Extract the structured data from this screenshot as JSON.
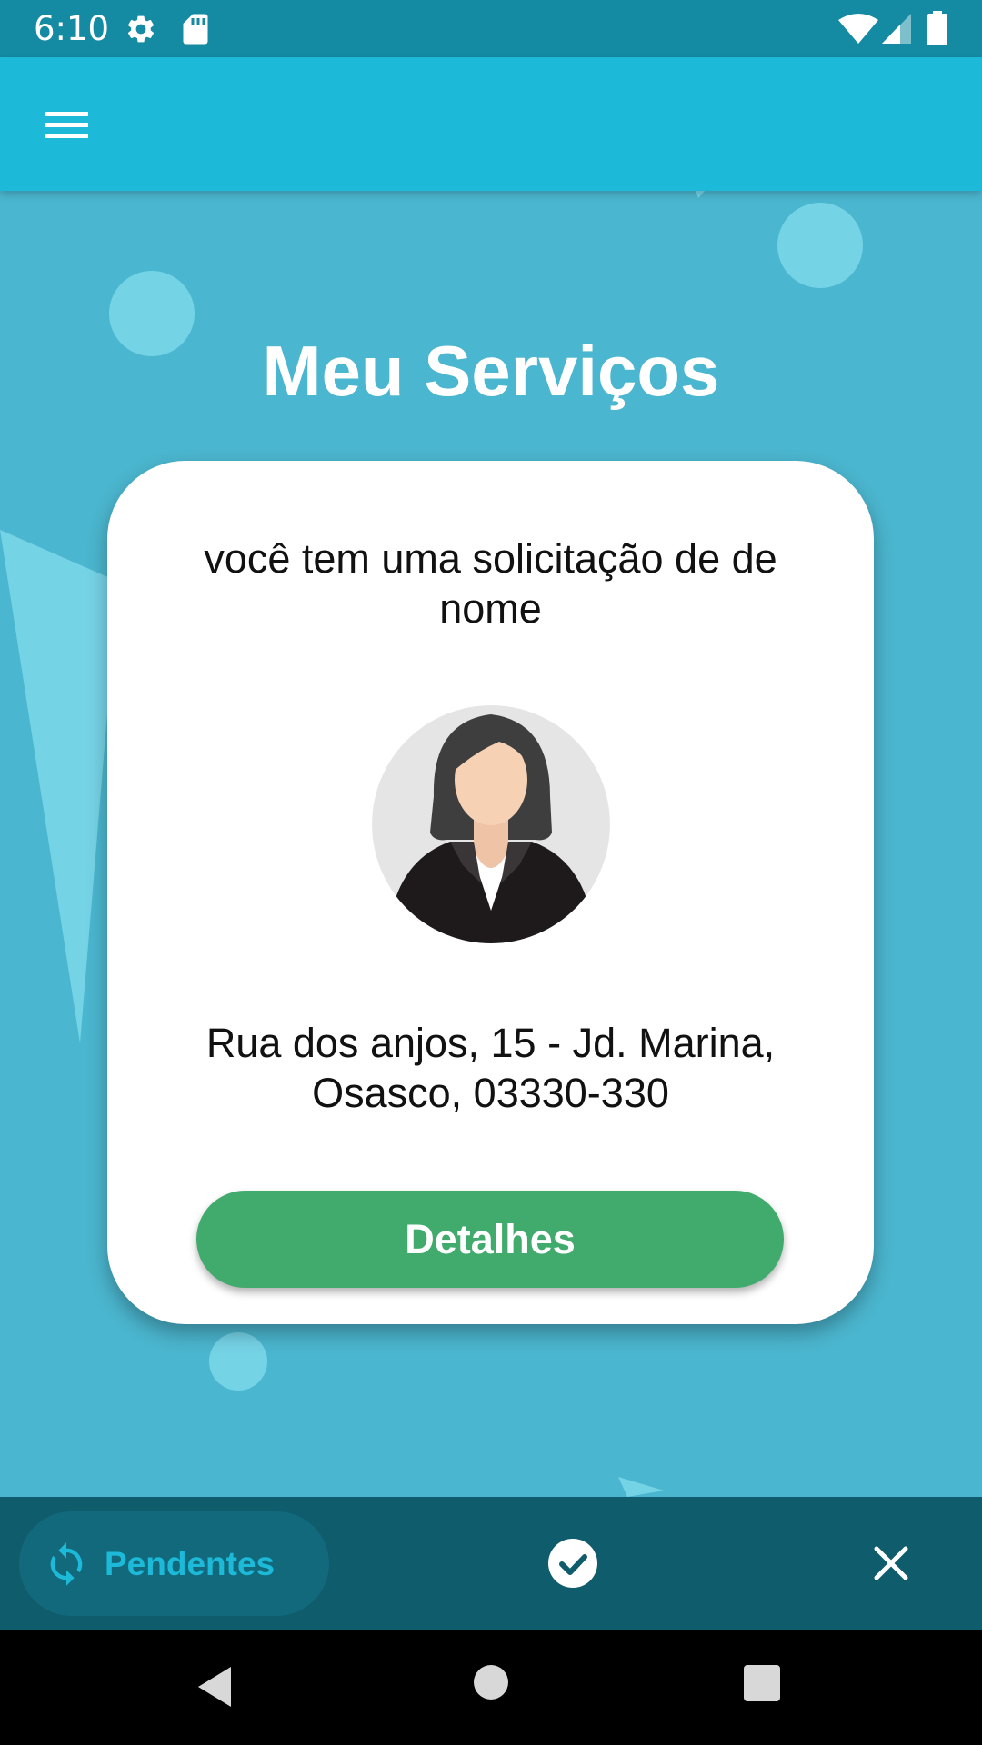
{
  "status_bar": {
    "time": "6:10",
    "icons": [
      "settings-icon",
      "sd-card-icon",
      "wifi-icon",
      "signal-icon",
      "battery-icon"
    ]
  },
  "app_bar": {
    "menu_icon": "hamburger-menu-icon"
  },
  "page": {
    "title": "Meu Serviços"
  },
  "card": {
    "message": "você tem uma solicitação de de nome",
    "avatar": "woman-avatar",
    "address_line1": "Rua dos anjos, 15 - Jd. Marina,",
    "address_line2": "Osasco, 03330-330",
    "details_label": "Detalhes"
  },
  "bottom_nav": {
    "tabs": [
      {
        "label": "Pendentes",
        "icon": "sync-icon",
        "selected": true
      },
      {
        "label": "",
        "icon": "check-circle-icon",
        "selected": false
      },
      {
        "label": "",
        "icon": "close-icon",
        "selected": false
      }
    ]
  },
  "system_nav": {
    "buttons": [
      "back-icon",
      "home-icon",
      "recents-icon"
    ]
  },
  "colors": {
    "status_bar": "#148aa3",
    "app_bar": "#1db9d8",
    "background": "#4bb6cf",
    "bottom_nav": "#0f5c6c",
    "accent": "#1db9d8",
    "button_green": "#40ab6c"
  }
}
